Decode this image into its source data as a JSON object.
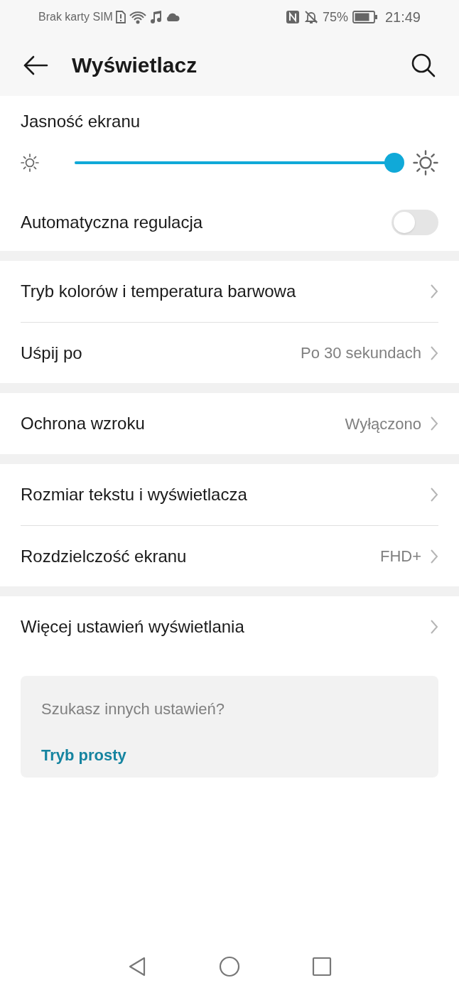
{
  "status_bar": {
    "carrier": "Brak karty SIM",
    "battery": "75%",
    "time": "21:49"
  },
  "header": {
    "title": "Wyświetlacz"
  },
  "brightness": {
    "label": "Jasność ekranu",
    "level": 1
  },
  "auto_adjust": {
    "label": "Automatyczna regulacja",
    "on": false
  },
  "groups": [
    [
      {
        "label": "Tryb kolorów i temperatura barwowa"
      },
      {
        "label": "Uśpij po",
        "value": "Po 30 sekundach"
      }
    ],
    [
      {
        "label": "Ochrona wzroku",
        "value": "Wyłączono"
      }
    ],
    [
      {
        "label": "Rozmiar tekstu i wyświetlacza"
      },
      {
        "label": "Rozdzielczość ekranu",
        "value": "FHD+"
      }
    ],
    [
      {
        "label": "Więcej ustawień wyświetlania"
      }
    ]
  ],
  "hint": {
    "text": "Szukasz innych ustawień?",
    "link": "Tryb prosty"
  }
}
